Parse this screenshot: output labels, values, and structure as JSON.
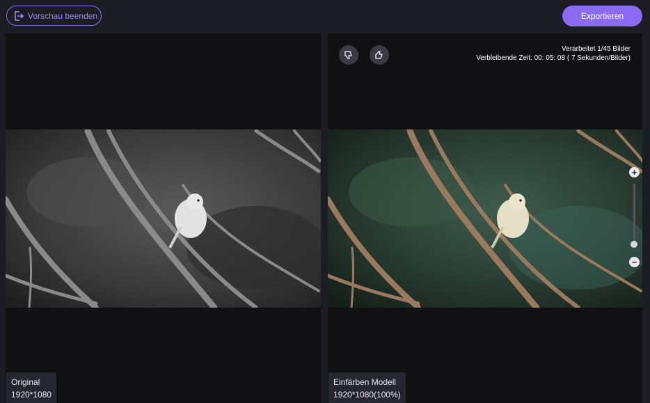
{
  "toolbar": {
    "exit_label": "Vorschau beenden",
    "exit_icon": "exit-icon",
    "export_label": "Exportieren",
    "accent_color": "#8b6bf2"
  },
  "left_panel": {
    "caption_title": "Original",
    "caption_size": "1920*1080"
  },
  "right_panel": {
    "caption_title": "Einfärben Modell",
    "caption_size": "1920*1080(100%)",
    "feedback": {
      "dislike_icon": "thumbs-down-icon",
      "like_icon": "thumbs-up-icon"
    },
    "progress_line": "Verarbeitet 1/45 Bilder",
    "remaining_line": "Verbleibende Zeit: 00: 05: 08 ( 7 Sekunden/Bilder)",
    "zoom": {
      "in_label": "+",
      "out_label": "−",
      "level": 0.0
    }
  }
}
